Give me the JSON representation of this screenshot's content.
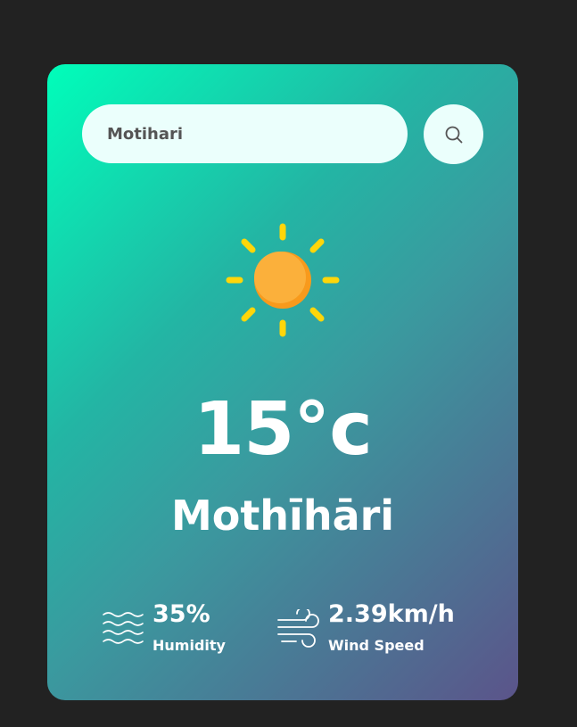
{
  "search": {
    "value": "Motihari",
    "icon": "search-icon"
  },
  "weather": {
    "icon": "sun-icon",
    "temperature": "15°c",
    "city": "Mothīhāri"
  },
  "details": {
    "humidity": {
      "icon": "humidity-waves-icon",
      "value": "35%",
      "label": "Humidity"
    },
    "wind": {
      "icon": "wind-icon",
      "value": "2.39km/h",
      "label": "Wind Speed"
    }
  },
  "colors": {
    "background": "#222222",
    "card_gradient_start": "#00feba",
    "card_gradient_end": "#5b548a",
    "input_bg": "#ebfffc",
    "sun_core": "#f9a93f",
    "sun_rays": "#ffd60a"
  }
}
